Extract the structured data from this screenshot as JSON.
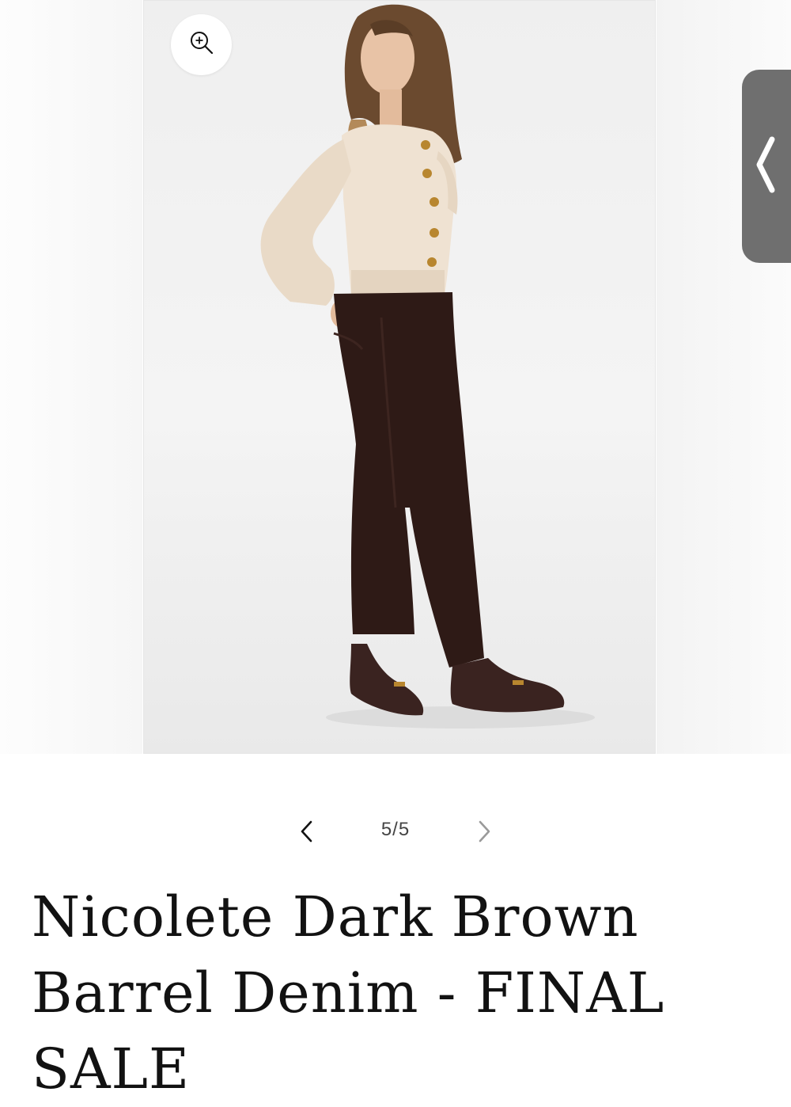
{
  "gallery": {
    "zoom_icon": "zoom-in-icon",
    "side_tab_icon": "chevron-left-icon",
    "slider": {
      "prev_icon": "chevron-left-icon",
      "next_icon": "chevron-right-icon",
      "counter": "5/5",
      "current": 5,
      "total": 5
    }
  },
  "product": {
    "title": "Nicolete Dark Brown Barrel Denim - FINAL SALE"
  },
  "colors": {
    "background": "#ffffff",
    "text": "#121212",
    "side_tab": "#6f6f6f",
    "pants": "#2e1a16",
    "cardigan": "#efe2d2"
  }
}
